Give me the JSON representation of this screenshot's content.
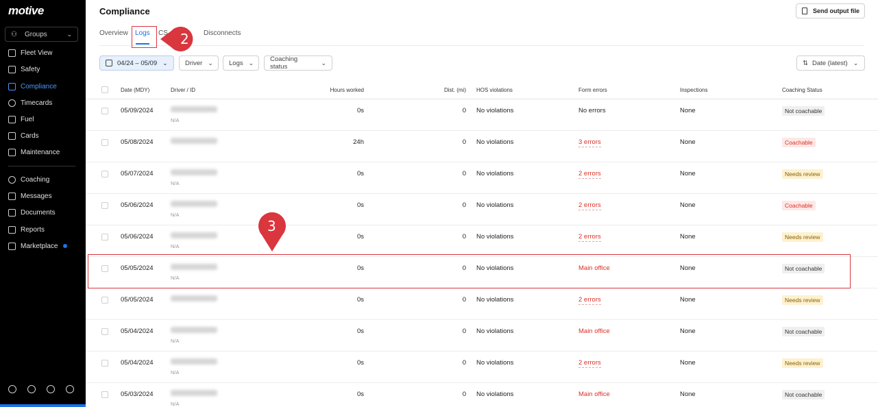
{
  "app": {
    "logo": "motive"
  },
  "sidebar": {
    "groups_label": "Groups",
    "items": [
      {
        "label": "Fleet View",
        "icon": "map-icon"
      },
      {
        "label": "Safety",
        "icon": "shield-icon"
      },
      {
        "label": "Compliance",
        "icon": "compliance-icon",
        "active": true
      },
      {
        "label": "Timecards",
        "icon": "clock-icon"
      },
      {
        "label": "Fuel",
        "icon": "fuel-icon"
      },
      {
        "label": "Cards",
        "icon": "card-icon"
      },
      {
        "label": "Maintenance",
        "icon": "wrench-icon"
      },
      {
        "label": "Coaching",
        "icon": "coaching-icon"
      },
      {
        "label": "Messages",
        "icon": "messages-icon"
      },
      {
        "label": "Documents",
        "icon": "documents-icon"
      },
      {
        "label": "Reports",
        "icon": "reports-icon"
      },
      {
        "label": "Marketplace",
        "icon": "marketplace-icon"
      }
    ]
  },
  "header": {
    "title": "Compliance",
    "send_button": "Send output file"
  },
  "tabs": [
    {
      "label": "Overview"
    },
    {
      "label": "Logs",
      "active": true
    },
    {
      "label": "CS"
    },
    {
      "label": "Disconnects"
    }
  ],
  "filters": {
    "date": "04/24 – 05/09",
    "driver": "Driver",
    "logs": "Logs",
    "coaching": "Coaching status",
    "sort": "Date (latest)"
  },
  "table": {
    "columns": [
      "Date (MDY)",
      "Driver / ID",
      "Hours worked",
      "Dist. (mi)",
      "HOS violations",
      "Form errors",
      "Inspections",
      "Coaching Status"
    ],
    "rows": [
      {
        "date": "05/09/2024",
        "sub": "N/A",
        "hours": "0s",
        "dist": "0",
        "hos": "No violations",
        "form": "No errors",
        "form_type": "plain",
        "insp": "None",
        "coach": "Not coachable",
        "coach_type": "nc"
      },
      {
        "date": "05/08/2024",
        "sub": "",
        "hours": "24h",
        "dist": "0",
        "hos": "No violations",
        "form": "3 errors",
        "form_type": "err",
        "insp": "None",
        "coach": "Coachable",
        "coach_type": "c"
      },
      {
        "date": "05/07/2024",
        "sub": "N/A",
        "hours": "0s",
        "dist": "0",
        "hos": "No violations",
        "form": "2 errors",
        "form_type": "err",
        "insp": "None",
        "coach": "Needs review",
        "coach_type": "nr"
      },
      {
        "date": "05/06/2024",
        "sub": "N/A",
        "hours": "0s",
        "dist": "0",
        "hos": "No violations",
        "form": "2 errors",
        "form_type": "err",
        "insp": "None",
        "coach": "Coachable",
        "coach_type": "c"
      },
      {
        "date": "05/06/2024",
        "sub": "N/A",
        "hours": "0s",
        "dist": "0",
        "hos": "No violations",
        "form": "2 errors",
        "form_type": "err",
        "insp": "None",
        "coach": "Needs review",
        "coach_type": "nr"
      },
      {
        "date": "05/05/2024",
        "sub": "N/A",
        "hours": "0s",
        "dist": "0",
        "hos": "No violations",
        "form": "Main office",
        "form_type": "office",
        "insp": "None",
        "coach": "Not coachable",
        "coach_type": "nc"
      },
      {
        "date": "05/05/2024",
        "sub": "",
        "hours": "0s",
        "dist": "0",
        "hos": "No violations",
        "form": "2 errors",
        "form_type": "err",
        "insp": "None",
        "coach": "Needs review",
        "coach_type": "nr"
      },
      {
        "date": "05/04/2024",
        "sub": "N/A",
        "hours": "0s",
        "dist": "0",
        "hos": "No violations",
        "form": "Main office",
        "form_type": "office",
        "insp": "None",
        "coach": "Not coachable",
        "coach_type": "nc"
      },
      {
        "date": "05/04/2024",
        "sub": "N/A",
        "hours": "0s",
        "dist": "0",
        "hos": "No violations",
        "form": "2 errors",
        "form_type": "err",
        "insp": "None",
        "coach": "Needs review",
        "coach_type": "nr"
      },
      {
        "date": "05/03/2024",
        "sub": "N/A",
        "hours": "0s",
        "dist": "0",
        "hos": "No violations",
        "form": "Main office",
        "form_type": "office",
        "insp": "None",
        "coach": "Not coachable",
        "coach_type": "nc"
      }
    ]
  },
  "annotations": {
    "callout_tab": "2",
    "callout_row": "3"
  },
  "colors": {
    "accent": "#1a73e8",
    "annotation": "#d9363e",
    "error": "#d93025"
  }
}
